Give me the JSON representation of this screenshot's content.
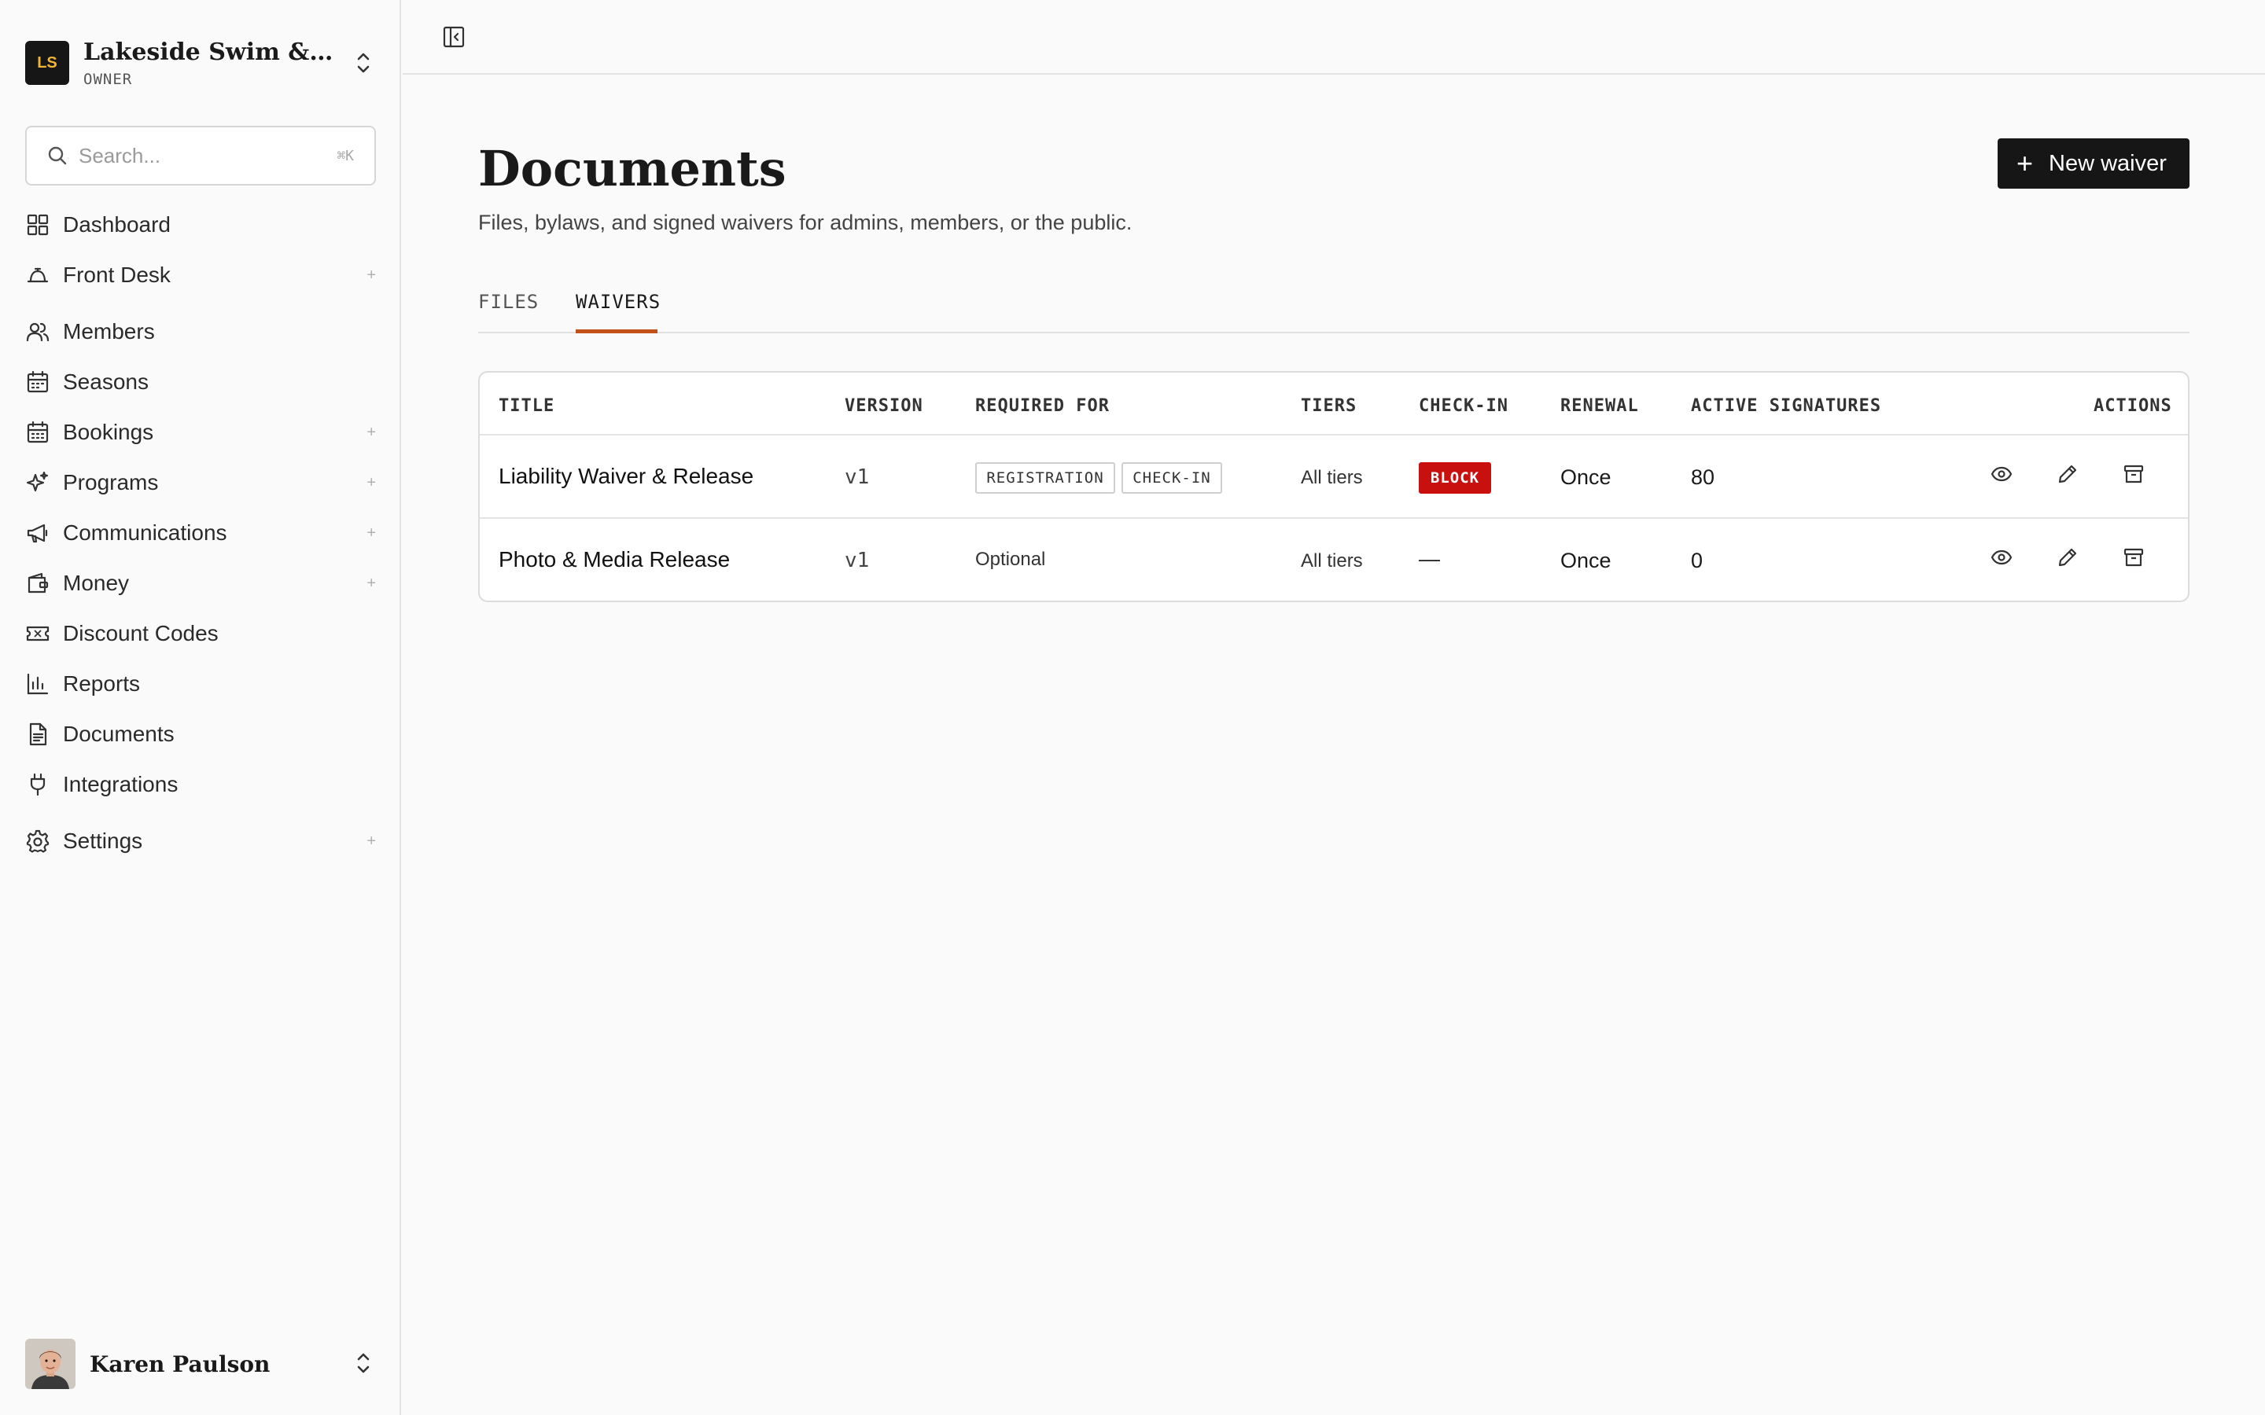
{
  "org": {
    "initials": "LS",
    "name": "Lakeside Swim & Ten...",
    "role": "OWNER"
  },
  "search": {
    "placeholder": "Search...",
    "shortcut": "⌘K"
  },
  "nav": [
    {
      "label": "Dashboard",
      "icon": "dashboard-icon",
      "expandable": false
    },
    {
      "label": "Front Desk",
      "icon": "bell-icon",
      "expandable": true
    },
    {
      "label": "Members",
      "icon": "users-icon",
      "expandable": false
    },
    {
      "label": "Seasons",
      "icon": "calendar-icon",
      "expandable": false
    },
    {
      "label": "Bookings",
      "icon": "calendar-check-icon",
      "expandable": true
    },
    {
      "label": "Programs",
      "icon": "sparkles-icon",
      "expandable": true
    },
    {
      "label": "Communications",
      "icon": "megaphone-icon",
      "expandable": true
    },
    {
      "label": "Money",
      "icon": "wallet-icon",
      "expandable": true
    },
    {
      "label": "Discount Codes",
      "icon": "ticket-icon",
      "expandable": false
    },
    {
      "label": "Reports",
      "icon": "bar-chart-icon",
      "expandable": false
    },
    {
      "label": "Documents",
      "icon": "document-icon",
      "expandable": false
    },
    {
      "label": "Integrations",
      "icon": "plug-icon",
      "expandable": false
    },
    {
      "label": "Settings",
      "icon": "gear-icon",
      "expandable": true
    }
  ],
  "nav_plus": "+",
  "user": {
    "name": "Karen Paulson"
  },
  "page": {
    "title": "Documents",
    "subtitle": "Files, bylaws, and signed waivers for admins, members, or the public.",
    "new_button": "New waiver",
    "new_button_plus": "+"
  },
  "tabs": [
    {
      "label": "FILES",
      "active": false
    },
    {
      "label": "WAIVERS",
      "active": true
    }
  ],
  "table": {
    "headers": {
      "title": "TITLE",
      "version": "VERSION",
      "required_for": "REQUIRED FOR",
      "tiers": "TIERS",
      "check_in": "CHECK-IN",
      "renewal": "RENEWAL",
      "active_signatures": "ACTIVE SIGNATURES",
      "actions": "ACTIONS"
    },
    "rows": [
      {
        "title": "Liability Waiver & Release",
        "version": "v1",
        "required_for": [
          "REGISTRATION",
          "CHECK-IN"
        ],
        "tiers": "All tiers",
        "check_in": "BLOCK",
        "renewal": "Once",
        "active_signatures": "80"
      },
      {
        "title": "Photo & Media Release",
        "version": "v1",
        "required_for_text": "Optional",
        "tiers": "All tiers",
        "check_in": "—",
        "renewal": "Once",
        "active_signatures": "0"
      }
    ],
    "action_icons": [
      "eye-icon",
      "pencil-icon",
      "archive-icon"
    ]
  },
  "colors": {
    "accent": "#c2521a",
    "block": "#c8100f",
    "dark": "#161616",
    "logo_text": "#f2b632"
  }
}
